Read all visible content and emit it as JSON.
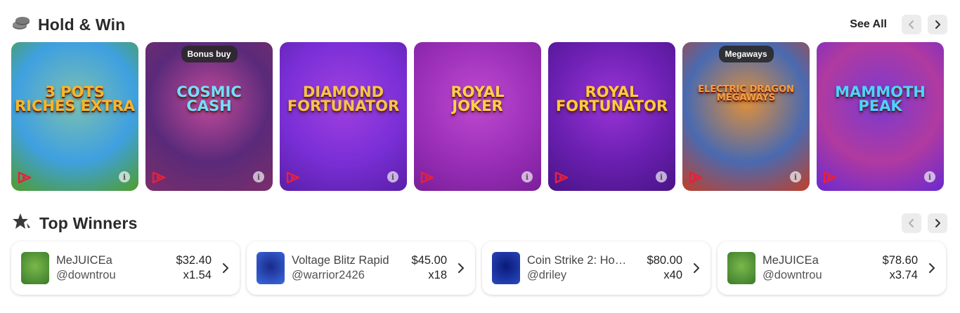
{
  "hold_win": {
    "title": "Hold & Win",
    "see_all": "See All",
    "games": [
      {
        "name": "3 Pots Riches Extra",
        "logo": "3 POTS\nRICHES EXTRA",
        "badge": "",
        "colors": [
          "#3fa0e0",
          "#7cc0b0",
          "#4f9d2a"
        ]
      },
      {
        "name": "Cosmic Cash",
        "logo": "COSMIC\nCASH",
        "badge": "Bonus buy",
        "colors": [
          "#5a2a7a",
          "#c44a9a",
          "#7a2e6a"
        ]
      },
      {
        "name": "Diamond Fortunator",
        "logo": "DIAMOND\nFORTUNATOR",
        "badge": "",
        "colors": [
          "#7a2fd6",
          "#a040e0",
          "#5a1fa8"
        ]
      },
      {
        "name": "Royal Joker",
        "logo": "ROYAL\nJOKER",
        "badge": "",
        "colors": [
          "#9a2fb8",
          "#c04ad0",
          "#7a1f9a"
        ]
      },
      {
        "name": "Royal Fortunator",
        "logo": "ROYAL\nFORTUNATOR",
        "badge": "",
        "colors": [
          "#6a1fb0",
          "#9a34d8",
          "#4a1488"
        ]
      },
      {
        "name": "Electric Dragon Megaways",
        "logo": "ELECTRIC DRAGON\nMEGAWAYS",
        "badge": "Megaways",
        "colors": [
          "#4a6ab0",
          "#e0903a",
          "#c0402a"
        ]
      },
      {
        "name": "Mammoth Peak",
        "logo": "MAMMOTH\nPEAK",
        "badge": "",
        "colors": [
          "#b03aa0",
          "#7a3ad0",
          "#6a2ad0"
        ]
      }
    ]
  },
  "top_winners": {
    "title": "Top Winners",
    "items": [
      {
        "game": "MeJUICEa",
        "user": "@downtrou",
        "amount": "$32.40",
        "multiplier": "x1.54",
        "thumb_colors": [
          "#7ab84a",
          "#3a7a2a"
        ]
      },
      {
        "game": "Voltage Blitz Rapid",
        "user": "@warrior2426",
        "amount": "$45.00",
        "multiplier": "x18",
        "thumb_colors": [
          "#1a2a8a",
          "#3a6ae0"
        ]
      },
      {
        "game": "Coin Strike 2: Ho…",
        "user": "@driley",
        "amount": "$80.00",
        "multiplier": "x40",
        "thumb_colors": [
          "#0a1a7a",
          "#2a4ac0"
        ]
      },
      {
        "game": "MeJUICEa",
        "user": "@downtrou",
        "amount": "$78.60",
        "multiplier": "x3.74",
        "thumb_colors": [
          "#7ab84a",
          "#3a7a2a"
        ]
      }
    ]
  },
  "icons": {
    "hold_win": "coins-icon",
    "top_winners": "star-icon",
    "nav_prev": "chevron-left-icon",
    "nav_next": "chevron-right-icon",
    "info": "info-icon",
    "provider": "provider-logo-icon"
  },
  "colors": {
    "info_label": "i"
  }
}
